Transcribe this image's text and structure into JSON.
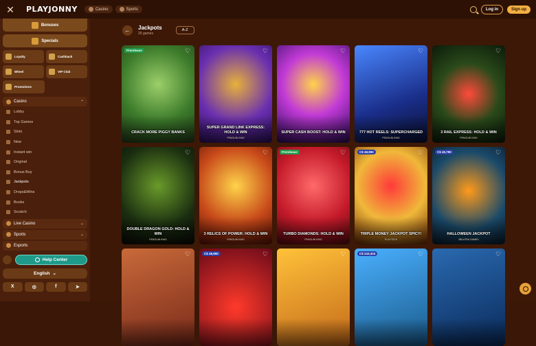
{
  "topbar": {
    "logo": "PLAYJONNY",
    "tabs": [
      {
        "label": "Casino"
      },
      {
        "label": "Sports"
      }
    ],
    "login_label": "Log in",
    "signup_label": "Sign up"
  },
  "sidebar": {
    "bonuses": "Bonuses",
    "specials": "Specials",
    "tiles": [
      "Loyalty",
      "Cashback",
      "Wheel",
      "VIP Club"
    ],
    "promotions": "Promotions",
    "casino_label": "Casino",
    "menu": [
      "Lobby",
      "Top Games",
      "Slots",
      "New",
      "Instant win",
      "Original",
      "Bonus Buy",
      "Jackpots",
      "Drops&Wins",
      "Books",
      "Scratch"
    ],
    "live_casino": "Live Casino",
    "sports": "Sports",
    "esports": "Esports",
    "help_center": "Help Center",
    "language": "English",
    "social": [
      "X",
      "◎",
      "f",
      "➤"
    ]
  },
  "main": {
    "title": "Jackpots",
    "subtitle": "25 games",
    "sort_label": "A-Z"
  },
  "games": [
    {
      "name": "CRACK MORE PIGGY BANKS",
      "provider": "",
      "badge": "Prerelease",
      "jackpot": ""
    },
    {
      "name": "SUPER GRAND LINK EXPRESS: HOLD & WIN",
      "provider": "PENGUIN KING",
      "badge": "",
      "jackpot": ""
    },
    {
      "name": "SUPER CASH BOOST: HOLD & WIN",
      "provider": "",
      "badge": "",
      "jackpot": ""
    },
    {
      "name": "777 HOT REELS: SUPERCHARGED",
      "provider": "PENGUIN KING",
      "badge": "",
      "jackpot": ""
    },
    {
      "name": "3 RAIL EXPRESS: HOLD & WIN",
      "provider": "PENGUIN KING",
      "badge": "",
      "jackpot": ""
    },
    {
      "name": "DOUBLE DRAGON GOLD: HOLD & WIN",
      "provider": "PENGUIN KING",
      "badge": "",
      "jackpot": ""
    },
    {
      "name": "3 RELICS OF POWER: HOLD & WIN",
      "provider": "PENGUIN KING",
      "badge": "",
      "jackpot": ""
    },
    {
      "name": "TURBO DIAMONDS: HOLD & WIN",
      "provider": "PENGUIN KING",
      "badge": "Prerelease",
      "jackpot": ""
    },
    {
      "name": "TRIPLE MONEY JACKPOT SPICY!",
      "provider": "PLAYTECH",
      "badge": "",
      "jackpot": "C$ 48,990"
    },
    {
      "name": "HALLOWEEN JACKPOT",
      "provider": "BELATRA GAMES",
      "badge": "",
      "jackpot": "C$ 40,790"
    },
    {
      "name": "",
      "provider": "",
      "badge": "",
      "jackpot": ""
    },
    {
      "name": "",
      "provider": "",
      "badge": "",
      "jackpot": "C$ 48,990"
    },
    {
      "name": "",
      "provider": "",
      "badge": "",
      "jackpot": ""
    },
    {
      "name": "",
      "provider": "",
      "badge": "",
      "jackpot": "C$ 243,324"
    },
    {
      "name": "",
      "provider": "",
      "badge": "",
      "jackpot": ""
    }
  ],
  "colors": {
    "background": "#3d1807",
    "sidebar": "#4a1f0b",
    "accent": "#f3b042",
    "help": "#1f9a8a"
  }
}
